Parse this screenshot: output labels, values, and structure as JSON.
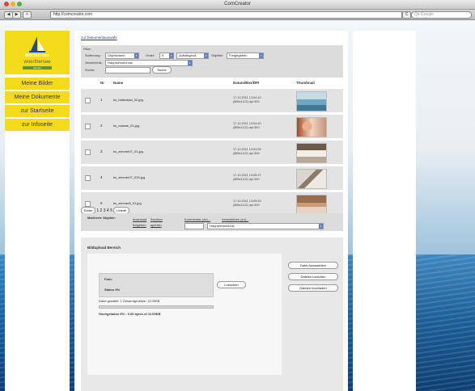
{
  "window": {
    "title": "ComCreator"
  },
  "toolbar": {
    "url": "http://comcreator.com",
    "search_placeholder": "Q▾ Google",
    "back": "◀",
    "forward": "▶",
    "add": "+",
    "reload": "C"
  },
  "brand": {
    "word": "Wörthersee",
    "name": "woerthersee",
    "tag": "kärnten"
  },
  "nav": {
    "meine_bilder": "Meine Bilder",
    "meine_dokumente": "Meine Dokumente",
    "zur_startseite": "zur Startseite",
    "zur_infoseite": "zur Infoseite"
  },
  "main": {
    "overview_link": "zur Dokumentauswahl",
    "filter": {
      "label": "Filter:",
      "sort_label": "Sortierung:",
      "sort_value": "Objektname",
      "order_label": "Order:",
      "order_value": "5",
      "direction_value": "Aufsteigend",
      "objects_label": "Objekte:",
      "objects_value": "Freigegeben",
      "folder_label": "Verzeichnis:",
      "folder_value": "Hauptverzeichnis",
      "search_label": "Suche:",
      "search_button": "Suche"
    },
    "columns": [
      "Nr",
      "Name",
      "Datum/Bex/DPI",
      "Thumbnail"
    ],
    "rows": [
      {
        "nr": "1",
        "name": "ks_hallenbad_02.jpg",
        "meta1": "17.10.2011 13:04:12",
        "meta2": "(885x1122) dpi:300"
      },
      {
        "nr": "2",
        "name": "ks_massie_01.jpg",
        "meta1": "17.10.2011 13:04:40",
        "meta2": "(885x1122) dpi:300"
      },
      {
        "nr": "3",
        "name": "ks_zimmer07_01.jpg",
        "meta1": "17.10.2011 13:04:58",
        "meta2": "(885x1122) dpi:300"
      },
      {
        "nr": "4",
        "name": "ks_zimmer07_015.jpg",
        "meta1": "17.10.2011 13:05:27",
        "meta2": "(885x1122) dpi:300"
      },
      {
        "nr": "5",
        "name": "ks_zimmer8_01.jpg",
        "meta1": "17.10.2011 13:05:53",
        "meta2": "(885x1122) dpi:300"
      }
    ],
    "pager": {
      "first": "Erster",
      "pages": "1 2 3 4 5",
      "last": "Letzter"
    },
    "marked": {
      "title": "Markierte Objekte:",
      "download": "download",
      "rechten": "Rechten",
      "freigeben": "freigeben",
      "sperren": "sperren",
      "kommentare": "Kommentar (zu)...",
      "verschieben": "Verschieben (zu)...",
      "target": "Hauptverzeichnis"
    },
    "upload": {
      "title": "Bildupload Bereich",
      "file_label": "Foto:",
      "status": "Status 0%",
      "delete_button": "Loeschen",
      "choose_button": "Datei Auswaehlen",
      "remove_button": "Dateien loeschen",
      "upload_button": "Dateien hochladen",
      "count_text": "Datei gewählt:  1   Gesamtgroesse:  11.09KB",
      "progress_text": "Hochgeladen 0% : 0.00 bytes of 11.09KB",
      "progress_fraction": 0.0
    }
  },
  "colors": {
    "brand": "#f3da1b",
    "accent": "#5b82c7",
    "link": "#2a3c8f"
  }
}
